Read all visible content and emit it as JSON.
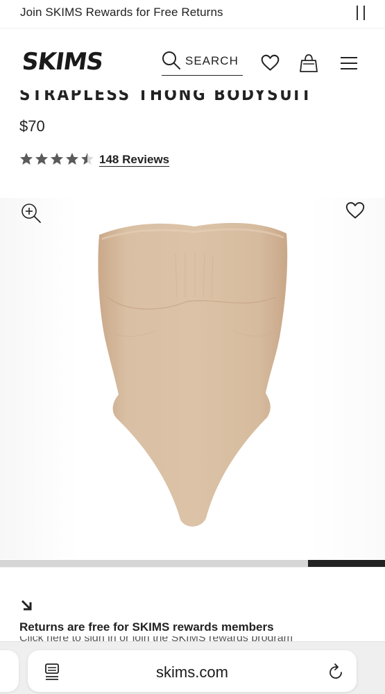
{
  "promo": {
    "text": "Join SKIMS Rewards for Free Returns"
  },
  "header": {
    "brand": "SKIMS",
    "search_label": "SEARCH"
  },
  "product": {
    "title": "STRAPLESS THONG BODYSUIT",
    "price": "$70",
    "rating": 4.5,
    "rating_max": 5,
    "reviews_label": "148 Reviews",
    "image_color": "#d9bfa3"
  },
  "gallery": {
    "progress_fraction": 0.2
  },
  "info": {
    "returns": "Returns are free for SKIMS rewards members",
    "subtext": "Click here to sign in or join the SKIMS rewards program"
  },
  "browser": {
    "url": "skims.com"
  },
  "colors": {
    "text": "#222222",
    "star": "#5a5a5a",
    "track": "#d6d6d6"
  },
  "icons": [
    "pause-icon",
    "search-icon",
    "heart-icon",
    "shopping-bag-icon",
    "menu-icon",
    "zoom-in-icon",
    "arrow-down-right-icon",
    "tabs-icon",
    "reload-icon"
  ]
}
